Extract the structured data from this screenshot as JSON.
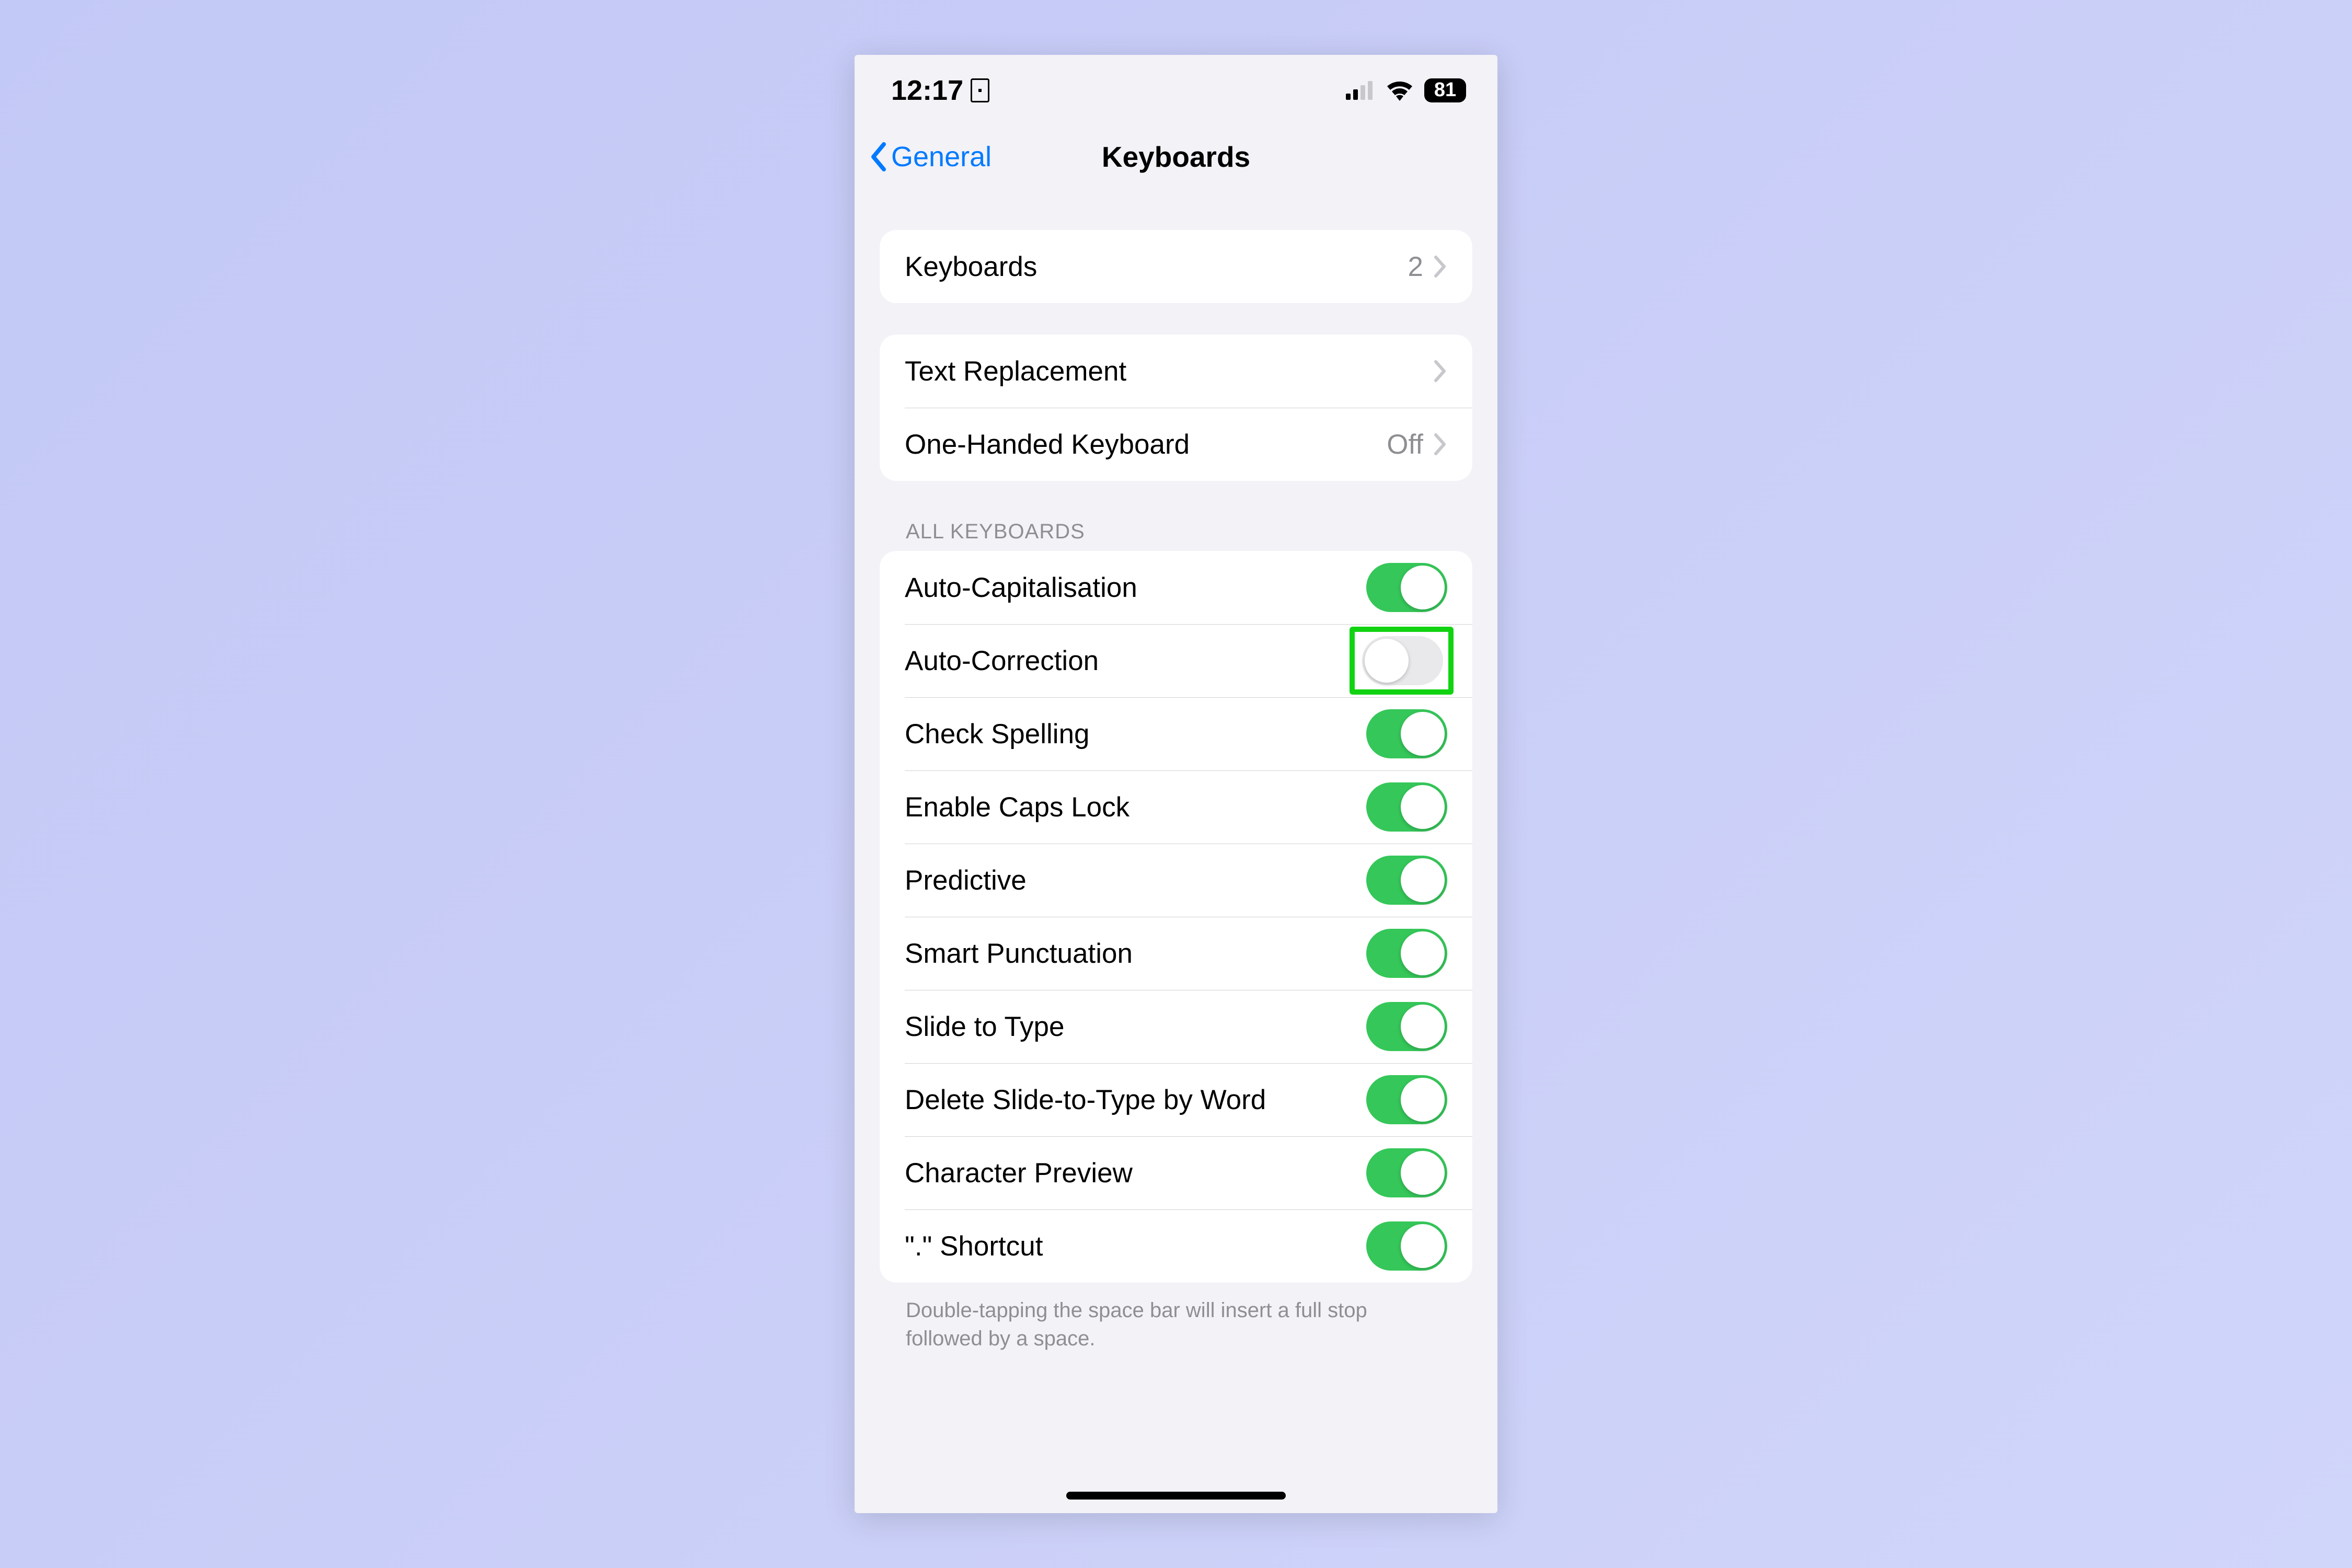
{
  "status_bar": {
    "time": "12:17",
    "battery_percent": "81"
  },
  "nav": {
    "back_label": "General",
    "title": "Keyboards"
  },
  "groups": {
    "keyboards": {
      "label": "Keyboards",
      "count": "2"
    },
    "options": {
      "text_replacement": {
        "label": "Text Replacement"
      },
      "one_handed": {
        "label": "One-Handed Keyboard",
        "value": "Off"
      }
    }
  },
  "all_keyboards": {
    "section_title": "ALL KEYBOARDS",
    "items": {
      "auto_cap": {
        "label": "Auto-Capitalisation",
        "on": true
      },
      "auto_correct": {
        "label": "Auto-Correction",
        "on": false
      },
      "check_spelling": {
        "label": "Check Spelling",
        "on": true
      },
      "caps_lock": {
        "label": "Enable Caps Lock",
        "on": true
      },
      "predictive": {
        "label": "Predictive",
        "on": true
      },
      "smart_punct": {
        "label": "Smart Punctuation",
        "on": true
      },
      "slide_type": {
        "label": "Slide to Type",
        "on": true
      },
      "delete_slide": {
        "label": "Delete Slide-to-Type by Word",
        "on": true
      },
      "char_preview": {
        "label": "Character Preview",
        "on": true
      },
      "dot_shortcut": {
        "label": "\".\" Shortcut",
        "on": true
      }
    },
    "footer": "Double-tapping the space bar will insert a full stop followed by a space."
  },
  "highlight": "auto_correct"
}
